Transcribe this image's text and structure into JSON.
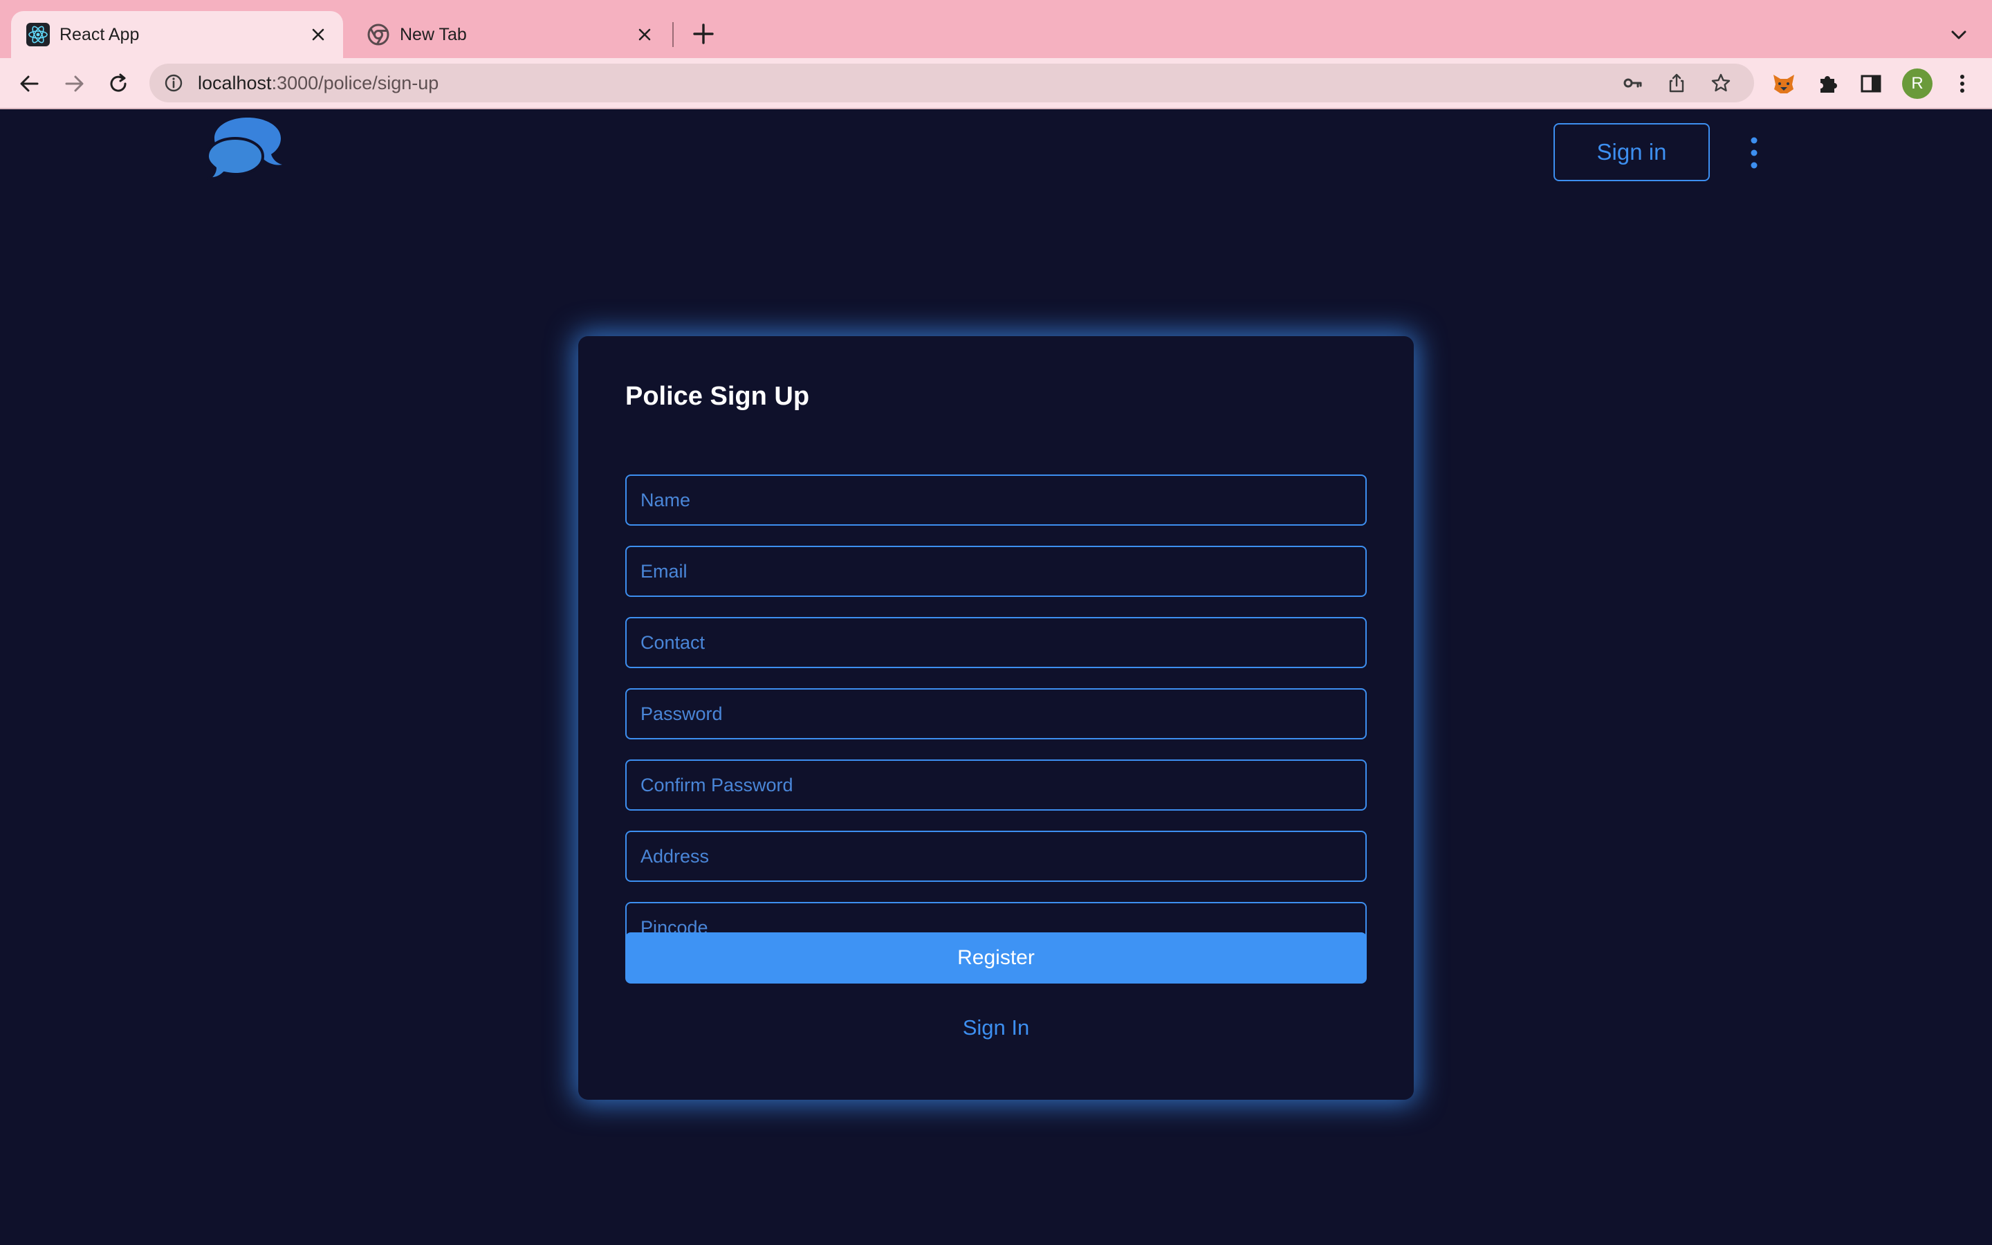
{
  "browser": {
    "tabs": [
      {
        "title": "React App",
        "active": true
      },
      {
        "title": "New Tab",
        "active": false
      }
    ],
    "url_host": "localhost",
    "url_rest": ":3000/police/sign-up",
    "profile_initial": "R"
  },
  "header": {
    "signin_label": "Sign in"
  },
  "form": {
    "title": "Police Sign Up",
    "fields": [
      {
        "placeholder": "Name"
      },
      {
        "placeholder": "Email"
      },
      {
        "placeholder": "Contact"
      },
      {
        "placeholder": "Password"
      },
      {
        "placeholder": "Confirm Password"
      },
      {
        "placeholder": "Address"
      },
      {
        "placeholder": "Pincode"
      }
    ],
    "register_label": "Register",
    "signin_link": "Sign In"
  },
  "colors": {
    "background": "#0f112b",
    "accent": "#3d8ff0",
    "button": "#3e93f4",
    "tabbar": "#f5b1c0"
  }
}
